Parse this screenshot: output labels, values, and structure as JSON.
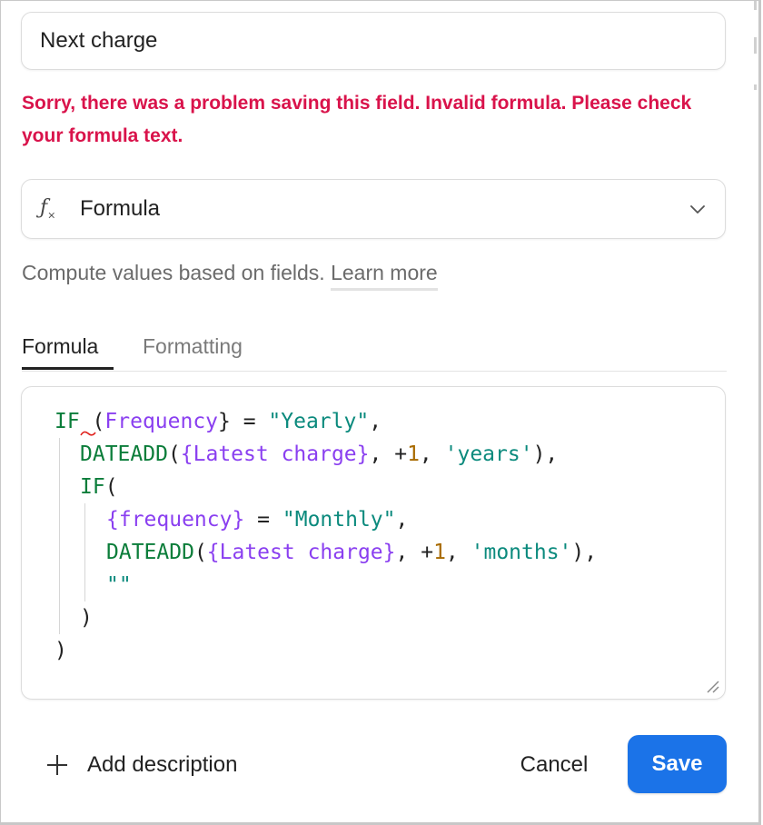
{
  "field": {
    "name_value": "Next charge",
    "error_message": "Sorry, there was a problem saving this field. Invalid formula. Please check your formula text."
  },
  "type_select": {
    "icon": "formula-fx-icon",
    "label": "Formula"
  },
  "hint": {
    "text": "Compute values based on fields.",
    "link_label": "Learn more"
  },
  "tabs": [
    {
      "label": "Formula",
      "active": true
    },
    {
      "label": "Formatting",
      "active": false
    }
  ],
  "formula_lines": [
    "IF (Frequency} = \"Yearly\",",
    "DATEADD({Latest charge}, +1, 'years'),",
    "IF(",
    "{frequency} = \"Monthly\",",
    "DATEADD({Latest charge}, +1, 'months'),",
    "\"\"",
    ")",
    ")"
  ],
  "footer": {
    "add_description_label": "Add description",
    "cancel_label": "Cancel",
    "save_label": "Save"
  },
  "colors": {
    "error": "#d9134b",
    "primary": "#1b73e8",
    "keyword": "#0b7d3a",
    "field_ref": "#8a3ff0",
    "string": "#0b8a7d",
    "number": "#a86a00"
  }
}
